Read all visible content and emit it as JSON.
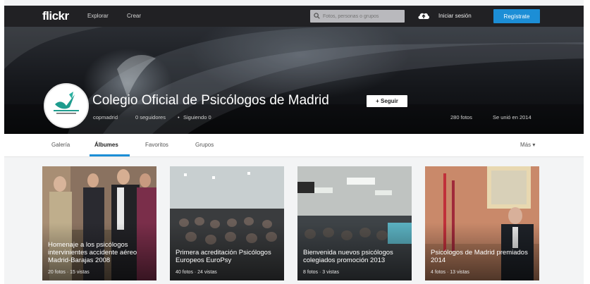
{
  "topbar": {
    "logo": "flickr",
    "nav": [
      "Explorar",
      "Crear"
    ],
    "search_placeholder": "Fotos, personas o grupos",
    "signin": "Iniciar sesión",
    "register": "Regístrate"
  },
  "profile": {
    "title": "Colegio Oficial de Psicólogos de Madrid",
    "follow": "+ Seguir",
    "username": "copmadrid",
    "followers": "0 seguidores",
    "following": "Siguiendo 0",
    "photos": "280 fotos",
    "joined": "Se unió en 2014"
  },
  "tabs": {
    "items": [
      "Galería",
      "Álbumes",
      "Favoritos",
      "Grupos"
    ],
    "active": "Álbumes",
    "more": "Más ▾"
  },
  "albums": [
    {
      "title": "Homenaje a los psicólogos intervinientes accidente aéreo Madrid-Barajas 2008",
      "count": "20 fotos · 15 vistas"
    },
    {
      "title": "Primera acreditación Psicólogos Europeos EuroPsy",
      "count": "40 fotos · 24 vistas"
    },
    {
      "title": "Bienvenida nuevos psicólogos colegiados promoción 2013",
      "count": "8 fotos · 3 vistas"
    },
    {
      "title": "Psicólogos de Madrid premiados 2014",
      "count": "4 fotos · 13 vistas"
    }
  ],
  "colors": {
    "topbar": "#212124",
    "accent": "#1c8ed6",
    "page_bg": "#f3f4f5"
  }
}
